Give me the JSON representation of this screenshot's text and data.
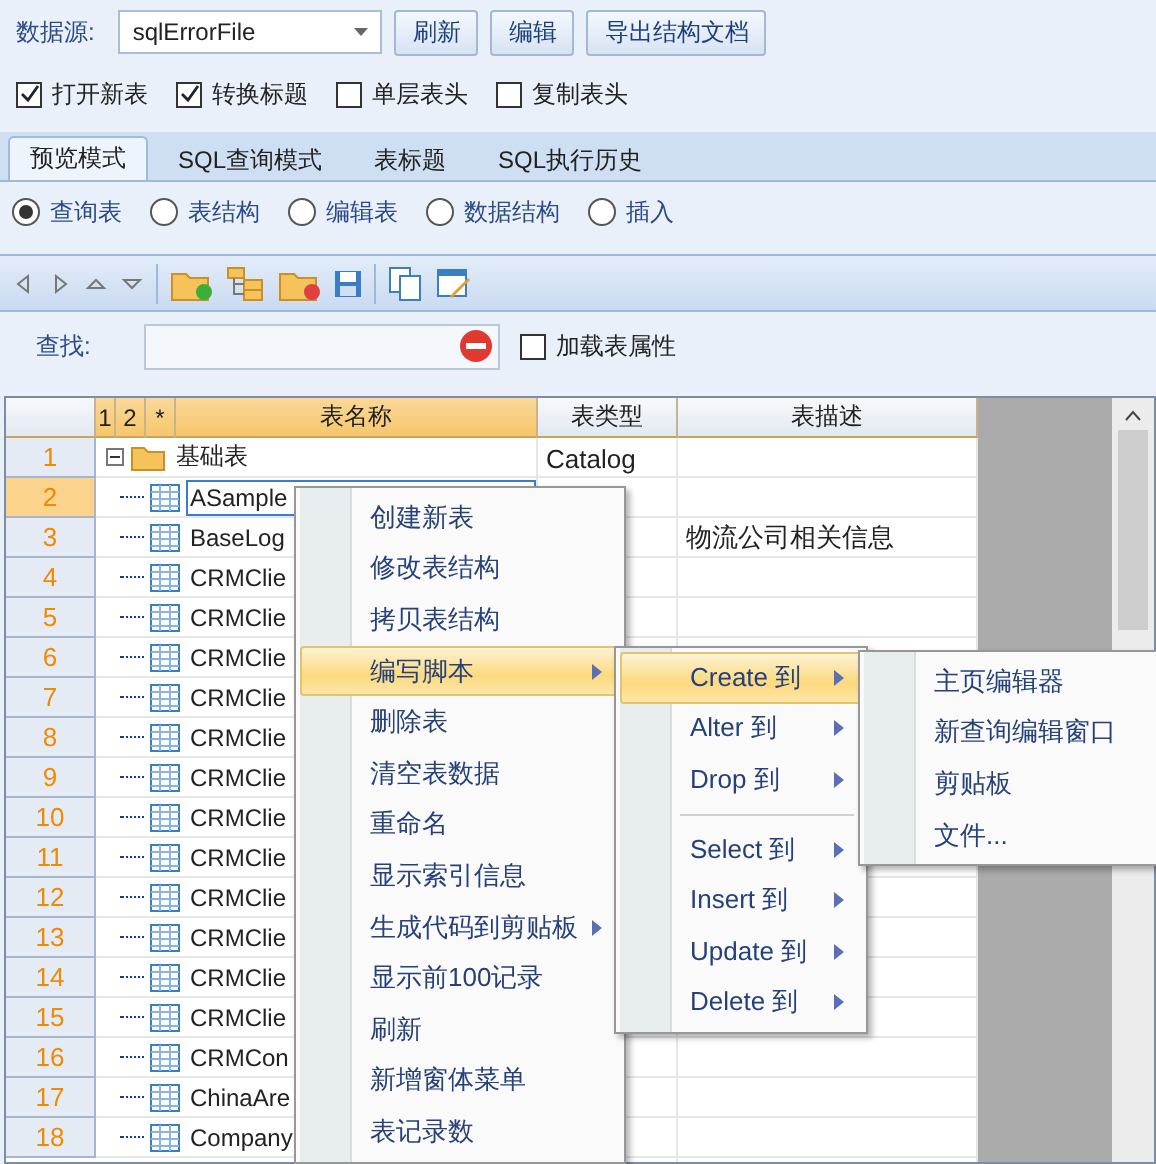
{
  "datasource": {
    "label": "数据源:",
    "value": "sqlErrorFile"
  },
  "buttons": [
    "刷新",
    "编辑",
    "导出结构文档"
  ],
  "options": [
    {
      "label": "打开新表",
      "checked": true
    },
    {
      "label": "转换标题",
      "checked": true
    },
    {
      "label": "单层表头",
      "checked": false
    },
    {
      "label": "复制表头",
      "checked": false
    }
  ],
  "tabs": [
    {
      "label": "预览模式",
      "selected": true
    },
    {
      "label": "SQL查询模式",
      "selected": false
    },
    {
      "label": "表标题",
      "selected": false
    },
    {
      "label": "SQL执行历史",
      "selected": false
    }
  ],
  "views": [
    {
      "label": "查询表",
      "selected": true
    },
    {
      "label": "表结构",
      "selected": false
    },
    {
      "label": "编辑表",
      "selected": false
    },
    {
      "label": "数据结构",
      "selected": false
    },
    {
      "label": "插入",
      "selected": false
    }
  ],
  "search": {
    "label": "查找:"
  },
  "load_properties": {
    "label": "加载表属性",
    "checked": false
  },
  "grid": {
    "columns": [
      "1",
      "2",
      "*",
      "表名称",
      "表类型",
      "表描述"
    ],
    "rows": [
      {
        "number": "1",
        "selected": false,
        "kind": "folder",
        "name": "基础表",
        "type": "Catalog",
        "description": ""
      },
      {
        "number": "2",
        "selected": true,
        "kind": "table",
        "name": "ASample",
        "type": "",
        "description": ""
      },
      {
        "number": "3",
        "selected": false,
        "kind": "table",
        "name": "BaseLog",
        "type": "",
        "description": "物流公司相关信息"
      },
      {
        "number": "4",
        "selected": false,
        "kind": "table",
        "name": "CRMClie",
        "type": "",
        "description": ""
      },
      {
        "number": "5",
        "selected": false,
        "kind": "table",
        "name": "CRMClie",
        "type": "",
        "description": ""
      },
      {
        "number": "6",
        "selected": false,
        "kind": "table",
        "name": "CRMClie",
        "type": "",
        "description": ""
      },
      {
        "number": "7",
        "selected": false,
        "kind": "table",
        "name": "CRMClie",
        "type": "",
        "description": ""
      },
      {
        "number": "8",
        "selected": false,
        "kind": "table",
        "name": "CRMClie",
        "type": "",
        "description": ""
      },
      {
        "number": "9",
        "selected": false,
        "kind": "table",
        "name": "CRMClie",
        "type": "",
        "description": ""
      },
      {
        "number": "10",
        "selected": false,
        "kind": "table",
        "name": "CRMClie",
        "type": "",
        "description": ""
      },
      {
        "number": "11",
        "selected": false,
        "kind": "table",
        "name": "CRMClie",
        "type": "",
        "description": ""
      },
      {
        "number": "12",
        "selected": false,
        "kind": "table",
        "name": "CRMClie",
        "type": "",
        "description": ""
      },
      {
        "number": "13",
        "selected": false,
        "kind": "table",
        "name": "CRMClie",
        "type": "",
        "description": ""
      },
      {
        "number": "14",
        "selected": false,
        "kind": "table",
        "name": "CRMClie",
        "type": "",
        "description": ""
      },
      {
        "number": "15",
        "selected": false,
        "kind": "table",
        "name": "CRMClie",
        "type": "",
        "description": ""
      },
      {
        "number": "16",
        "selected": false,
        "kind": "table",
        "name": "CRMCon",
        "type": "",
        "description": ""
      },
      {
        "number": "17",
        "selected": false,
        "kind": "table",
        "name": "ChinaAre",
        "type": "",
        "description": ""
      },
      {
        "number": "18",
        "selected": false,
        "kind": "table",
        "name": "Company",
        "type": "",
        "description": ""
      }
    ]
  },
  "context_menu": [
    {
      "label": "创建新表",
      "selected": false,
      "submenu": false
    },
    {
      "label": "修改表结构",
      "selected": false,
      "submenu": false
    },
    {
      "label": "拷贝表结构",
      "selected": false,
      "submenu": false
    },
    {
      "label": "编写脚本",
      "selected": true,
      "submenu": true
    },
    {
      "label": "删除表",
      "selected": false,
      "submenu": false
    },
    {
      "label": "清空表数据",
      "selected": false,
      "submenu": false
    },
    {
      "label": "重命名",
      "selected": false,
      "submenu": false
    },
    {
      "label": "显示索引信息",
      "selected": false,
      "submenu": false
    },
    {
      "label": "生成代码到剪贴板",
      "selected": false,
      "submenu": true
    },
    {
      "label": "显示前100记录",
      "selected": false,
      "submenu": false
    },
    {
      "label": "刷新",
      "selected": false,
      "submenu": false
    },
    {
      "label": "新增窗体菜单",
      "selected": false,
      "submenu": false
    },
    {
      "label": "表记录数",
      "selected": false,
      "submenu": false
    }
  ],
  "script_menu": [
    {
      "kind": "item",
      "label": "Create 到",
      "selected": true
    },
    {
      "kind": "item",
      "label": "Alter 到",
      "selected": false
    },
    {
      "kind": "item",
      "label": "Drop 到",
      "selected": false
    },
    {
      "kind": "separator"
    },
    {
      "kind": "item",
      "label": "Select 到",
      "selected": false
    },
    {
      "kind": "item",
      "label": "Insert 到",
      "selected": false
    },
    {
      "kind": "item",
      "label": "Update 到",
      "selected": false
    },
    {
      "kind": "item",
      "label": "Delete 到",
      "selected": false
    }
  ],
  "target_menu": [
    {
      "label": "主页编辑器"
    },
    {
      "label": "新查询编辑窗口"
    },
    {
      "label": "剪贴板"
    },
    {
      "label": "文件..."
    }
  ]
}
